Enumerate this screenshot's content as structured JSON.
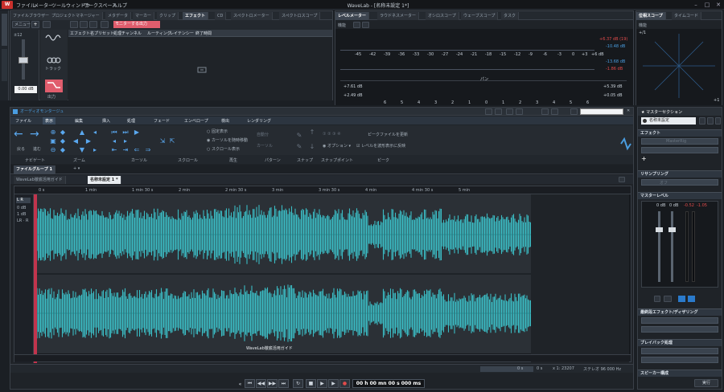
{
  "app": {
    "icon_text": "W",
    "title": "WaveLab - [名称未設定 1*]"
  },
  "menu": [
    "ファイル",
    "メーター",
    "ツールウィンドウ",
    "ワークスペース",
    "ヘルプ"
  ],
  "top_left": {
    "tabs": [
      "ファイルブラウザー",
      "プロジェクトマネージャー",
      "メタデータ",
      "マーカー",
      "クリップ",
      "エフェクト",
      "CD",
      "スペクトロメーター",
      "スペクトロスコープ"
    ],
    "active_tab": "エフェクト",
    "menu_label": "メニュー",
    "monitor_label": "モニターする出力",
    "columns": [
      "エフェクト名",
      "プリセット",
      "処理チャンネル",
      "ルーティング",
      "レイテンシー",
      "終了時間"
    ],
    "side": {
      "level": "±12",
      "value": "0.00 dB",
      "track_label": "トラック",
      "output_label": "出力"
    }
  },
  "level_meter": {
    "tabs": [
      "レベルメーター",
      "ラウドネスメーター",
      "オシロスコープ",
      "ウェーブスコープ",
      "タスク"
    ],
    "function_label": "機能",
    "scale": [
      "-45",
      "-42",
      "-39",
      "-36",
      "-33",
      "-30",
      "-27",
      "-24",
      "-21",
      "-18",
      "-15",
      "-12",
      "-9",
      "-6",
      "-3",
      "0",
      "+3",
      "+6 dB"
    ],
    "right_top": [
      "+6.37 dB (19)",
      "-10.48 dB",
      "-13.68 dB",
      "-1.86 dB"
    ],
    "pan_label": "パン",
    "left_bottom": [
      "+7.61 dB",
      "+2.49 dB"
    ],
    "right_bottom": [
      "+5.39 dB",
      "+0.05 dB"
    ],
    "pan_scale": [
      "6",
      "5",
      "4",
      "3",
      "2",
      "1",
      "0",
      "1",
      "2",
      "3",
      "4",
      "5",
      "6"
    ]
  },
  "phase_scope": {
    "tabs": [
      "位相スコープ",
      "タイムコード"
    ],
    "function_label": "機能",
    "corner_tl": "+/1",
    "corner_br": "+1"
  },
  "montage": {
    "title": "オーディオモンタージュ",
    "ribbon_tabs": [
      "ファイル",
      "表示",
      "編集",
      "挿入",
      "処理",
      "フェード",
      "エンベロープ",
      "検出",
      "レンダリング"
    ],
    "active_ribbon_tab": "表示",
    "nav": {
      "back": "戻る",
      "forward": "進む"
    },
    "groups": [
      "カーソル",
      "ズーム",
      "スクロール",
      "再生",
      "パターン",
      "スナップ",
      "スナップポイント",
      "ピーク"
    ],
    "display_options": [
      "固定表示",
      "カーソルを随時移動",
      "スクロール表示"
    ],
    "mid_options": [
      "自動分",
      "カーソル"
    ],
    "options_label": "オプション",
    "peak": {
      "update": "ピークファイルを更新",
      "reflect": "レベルを波形表示に反映"
    },
    "file_tabs": [
      "ファイルグループ 1"
    ],
    "doc_tabs": [
      "WaveLab徹底活用ガイド",
      "名称未設定 1 *"
    ],
    "ruler": [
      "0 s",
      "1 min",
      "1 min 30 s",
      "2 min",
      "2 min 30 s",
      "3 min",
      "3 min 30 s",
      "4 min",
      "4 min 30 s",
      "5 min"
    ],
    "track": {
      "label": "L R",
      "lines": [
        "0 dB",
        "1 dB",
        "LR · R"
      ]
    },
    "clip_name": "WaveLab徹底活用ガイド",
    "status": {
      "start": "0 s",
      "pos": "0 s",
      "zoom": "x 1: 23207",
      "format": "ステレオ 96 000 Hz"
    },
    "time_display": "00 h 00 mn 00 s 000 ms"
  },
  "master": {
    "title": "マスターセクション",
    "preset_label": "名称未設定",
    "effects_label": "エフェクト",
    "slot1": "MasterRig",
    "resample_label": "リサンプリング",
    "resample_value": "オフ",
    "master_level_label": "マスターレベル",
    "levels": [
      "0 dB",
      "0 dB",
      "-0.52",
      "-1.05"
    ],
    "final_label": "最終段エフェクト/ディザリング",
    "playback_label": "プレイバック処理",
    "speaker_label": "スピーカー構成",
    "render_label": "実行"
  },
  "colors": {
    "wave": "#3bbcc4",
    "accent": "#4a9de0",
    "record": "#e24b4b",
    "cursor": "#c2344d"
  }
}
